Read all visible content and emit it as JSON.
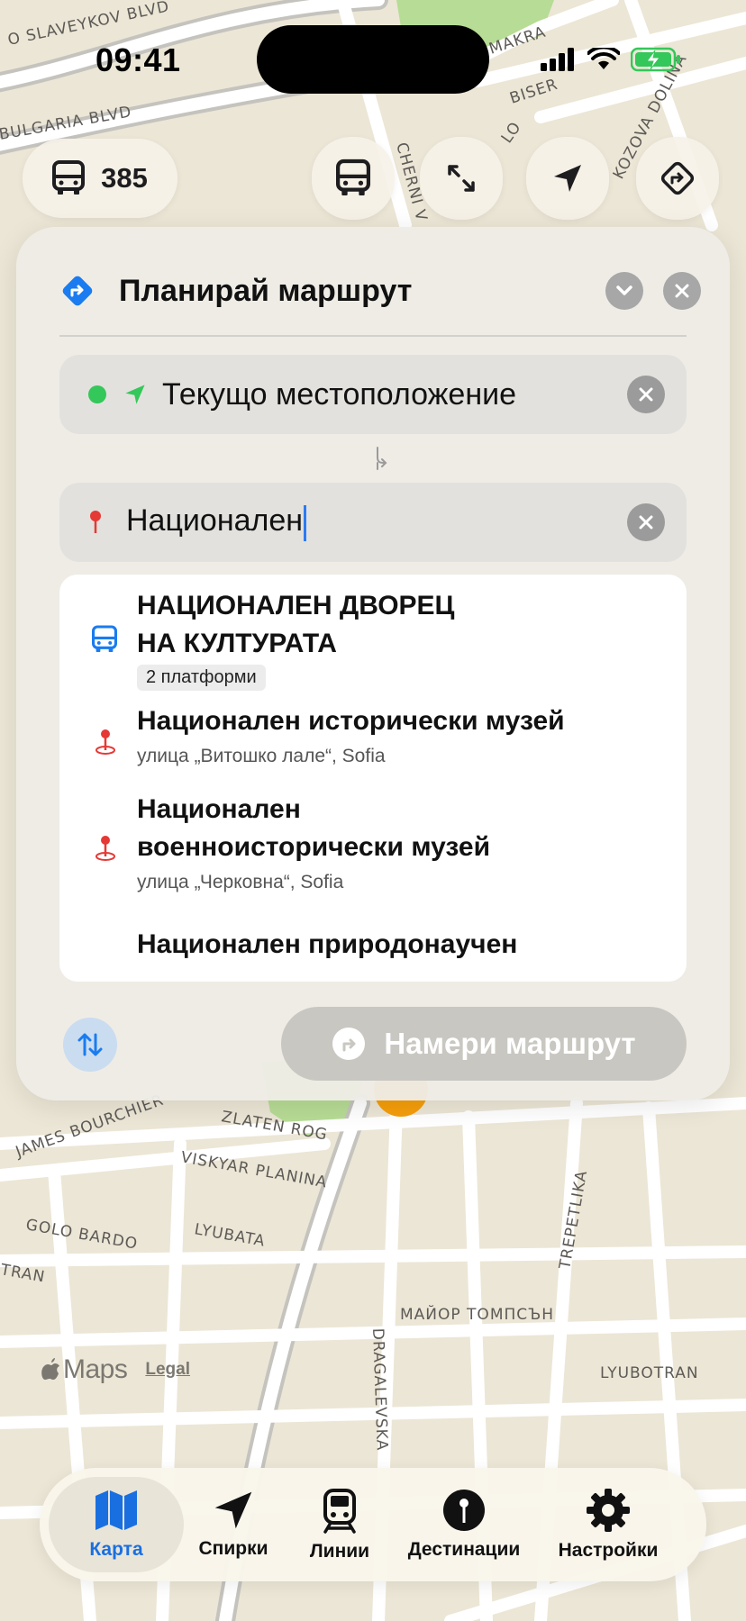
{
  "status_bar": {
    "time": "09:41"
  },
  "top_controls": {
    "route_number": "385"
  },
  "map_labels": {
    "slaveykov": "O SLAVEYKOV BLVD",
    "bulgaria": "BULGARIA BLVD",
    "cherni": "CHERNI V",
    "makra": "MAKRA",
    "biser": "BISER",
    "lo": "LO",
    "kozova": "KOZOVA DOLINA",
    "zlaten_rog": "ZLATEN ROG",
    "james": "JAMES BOURCHIER",
    "viskyar": "VISKYAR PLANINA",
    "golo": "GOLO BARDO",
    "lyubata": "LYUBATA",
    "tran": "TRAN",
    "trepetlika": "TREPETLIKA",
    "major": "МАЙОР ТОМПСЪН",
    "dragalevska": "DRAGALEVSKA",
    "lyubotran": "LYUBOTRAN"
  },
  "panel": {
    "title": "Планирай маршрут",
    "from_value": "Текущо местоположение",
    "to_value": "Национален",
    "find_button": "Намери маршрут"
  },
  "results": [
    {
      "title_line1": "НАЦИОНАЛЕН ДВОРЕЦ",
      "title_line2": "НА КУЛТУРАТА",
      "badge": "2 платформи"
    },
    {
      "title": "Национален исторически музей",
      "subtitle": "улица „Витошко лале“, Sofia"
    },
    {
      "title_line1": "Национален",
      "title_line2": "военноисторически музей",
      "subtitle": "улица „Черковна“, Sofia"
    },
    {
      "title": "Национален природонаучен"
    }
  ],
  "attribution": {
    "maps": "Maps",
    "legal": "Legal"
  },
  "tabs": [
    {
      "label": "Карта",
      "icon": "map-icon",
      "active": true
    },
    {
      "label": "Спирки",
      "icon": "location-arrow-icon"
    },
    {
      "label": "Линии",
      "icon": "tram-icon"
    },
    {
      "label": "Дестинации",
      "icon": "pin-icon"
    },
    {
      "label": "Настройки",
      "icon": "gear-icon"
    }
  ],
  "colors": {
    "accent": "#1a6fe0",
    "current_location": "#34c759",
    "destination_pin": "#e53935",
    "map_bg": "#ece6d6",
    "park": "#b7dc95"
  }
}
